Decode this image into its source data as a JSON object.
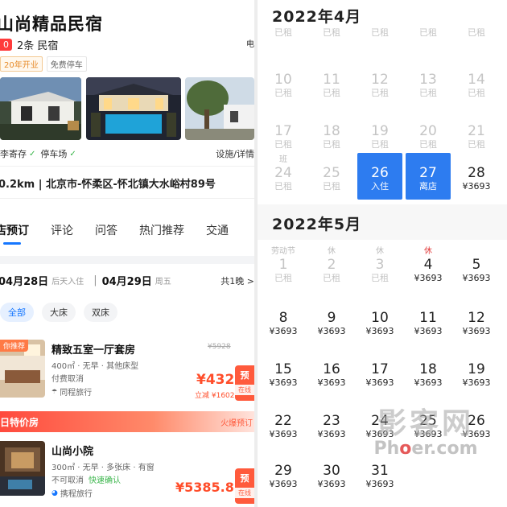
{
  "hotel": {
    "name": "山尚精品民宿",
    "score_badge": "0",
    "review_count": "2条 民宿",
    "map_hint": "电",
    "tags": [
      "20年开业",
      "免费停车"
    ],
    "amenities": [
      "李寄存",
      "停车场"
    ],
    "facilities_link": "设施/详情",
    "address": "0.2km | 北京市-怀柔区-怀北镇大水峪村89号"
  },
  "tabs": [
    "店预订",
    "评论",
    "问答",
    "热门推荐",
    "交通"
  ],
  "stay": {
    "checkin_date": "04月28日",
    "checkin_label": "后天入住",
    "checkout_date": "04月29日",
    "checkout_week": "周五",
    "separator": "|",
    "nights": "共1晚 >"
  },
  "filters": [
    "全部",
    "大床",
    "双床"
  ],
  "rooms": [
    {
      "badge": "你推荐",
      "name": "精致五室一厅套房",
      "desc": "400㎡ · 无早 · 其他床型",
      "cancel": "付费取消",
      "fast": "",
      "source": "同程旅行",
      "old_price": "¥5928",
      "price": "¥4326",
      "discount": "立减 ¥1602",
      "book": "预",
      "book_sub": "在线"
    },
    {
      "badge": "",
      "name": "山尚小院",
      "desc": "300㎡ · 无早 · 多张床 · 有窗",
      "cancel": "不可取消",
      "fast": "快速确认",
      "source": "携程旅行",
      "old_price": "",
      "price": "¥5385.88",
      "discount": "",
      "book": "预",
      "book_sub": "在线"
    }
  ],
  "special": {
    "label": "日特价房",
    "hot": "火爆预订"
  },
  "calendar": {
    "april_title": "2022年4月",
    "may_title": "2022年5月",
    "booked_label": "已租",
    "april_rows": [
      [
        {
          "n": "",
          "ab": "",
          "s": "已租",
          "past": true
        },
        {
          "n": "",
          "ab": "",
          "s": "已租",
          "past": true
        },
        {
          "n": "",
          "ab": "",
          "s": "已租",
          "past": true
        },
        {
          "n": "",
          "ab": "",
          "s": "已租",
          "past": true
        },
        {
          "n": "",
          "ab": "",
          "s": "已租",
          "past": true
        }
      ],
      [
        {
          "n": "10",
          "ab": "",
          "s": "已租",
          "past": true
        },
        {
          "n": "11",
          "ab": "",
          "s": "已租",
          "past": true
        },
        {
          "n": "12",
          "ab": "",
          "s": "已租",
          "past": true
        },
        {
          "n": "13",
          "ab": "",
          "s": "已租",
          "past": true
        },
        {
          "n": "14",
          "ab": "",
          "s": "已租",
          "past": true
        }
      ],
      [
        {
          "n": "17",
          "ab": "",
          "s": "已租",
          "past": true
        },
        {
          "n": "18",
          "ab": "",
          "s": "已租",
          "past": true
        },
        {
          "n": "19",
          "ab": "",
          "s": "已租",
          "past": true
        },
        {
          "n": "20",
          "ab": "",
          "s": "已租",
          "past": true
        },
        {
          "n": "21",
          "ab": "",
          "s": "已租",
          "past": true
        }
      ],
      [
        {
          "n": "24",
          "ab": "班",
          "s": "已租",
          "past": true
        },
        {
          "n": "25",
          "ab": "",
          "s": "已租",
          "past": true
        },
        {
          "n": "26",
          "ab": "",
          "s": "入住",
          "sel": true
        },
        {
          "n": "27",
          "ab": "",
          "s": "离店",
          "sel": true
        },
        {
          "n": "28",
          "ab": "",
          "s": "¥3693"
        }
      ]
    ],
    "may_rows": [
      [
        {
          "n": "1",
          "ab": "劳动节",
          "s": "已租",
          "past": true
        },
        {
          "n": "2",
          "ab": "休",
          "s": "已租",
          "past": true
        },
        {
          "n": "3",
          "ab": "休",
          "s": "已租",
          "past": true
        },
        {
          "n": "4",
          "ab": "休",
          "red": true,
          "s": "¥3693"
        },
        {
          "n": "5",
          "ab": "",
          "s": "¥3693"
        }
      ],
      [
        {
          "n": "8",
          "ab": "",
          "s": "¥3693"
        },
        {
          "n": "9",
          "ab": "",
          "s": "¥3693"
        },
        {
          "n": "10",
          "ab": "",
          "s": "¥3693"
        },
        {
          "n": "11",
          "ab": "",
          "s": "¥3693"
        },
        {
          "n": "12",
          "ab": "",
          "s": "¥3693"
        }
      ],
      [
        {
          "n": "15",
          "ab": "",
          "s": "¥3693"
        },
        {
          "n": "16",
          "ab": "",
          "s": "¥3693"
        },
        {
          "n": "17",
          "ab": "",
          "s": "¥3693"
        },
        {
          "n": "18",
          "ab": "",
          "s": "¥3693"
        },
        {
          "n": "19",
          "ab": "",
          "s": "¥3693"
        }
      ],
      [
        {
          "n": "22",
          "ab": "",
          "s": "¥3693"
        },
        {
          "n": "23",
          "ab": "",
          "s": "¥3693"
        },
        {
          "n": "24",
          "ab": "",
          "s": "¥3693"
        },
        {
          "n": "25",
          "ab": "",
          "s": "¥3693"
        },
        {
          "n": "26",
          "ab": "",
          "s": "¥3693"
        }
      ],
      [
        {
          "n": "29",
          "ab": "",
          "s": "¥3693"
        },
        {
          "n": "30",
          "ab": "",
          "s": "¥3693"
        },
        {
          "n": "31",
          "ab": "",
          "s": "¥3693"
        }
      ]
    ]
  },
  "watermark": {
    "line1": "影客网",
    "line2_a": "Ph",
    "line2_o": "o",
    "line2_b": "er.com"
  },
  "colors": {
    "accent": "#2d7cf0",
    "price": "#ff4d2a",
    "ok": "#39b54a"
  }
}
